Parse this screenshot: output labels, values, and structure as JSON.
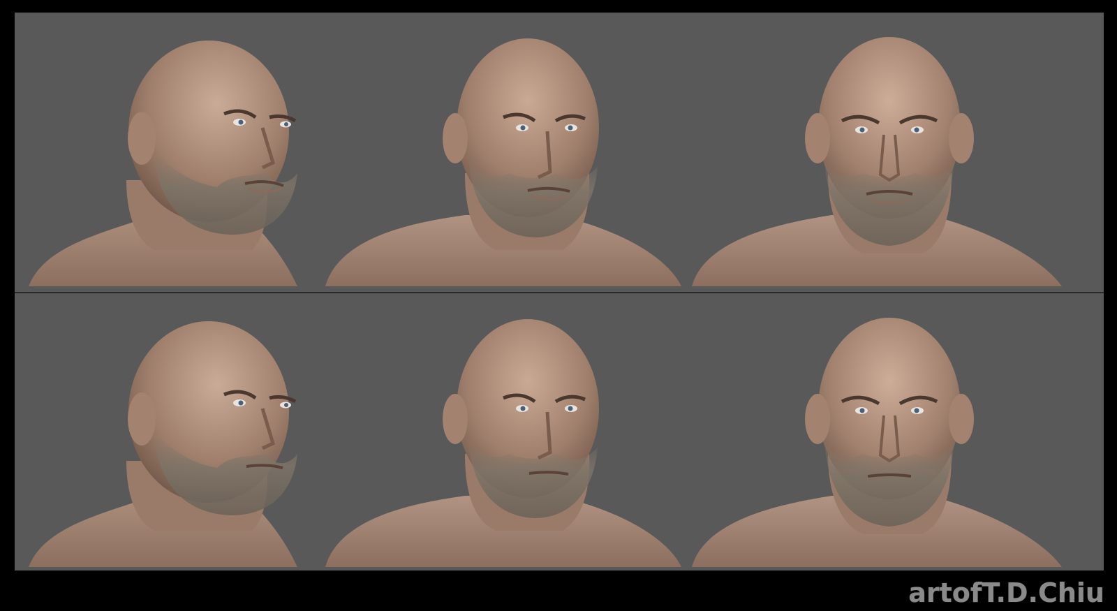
{
  "artwork": {
    "description_rows": [
      {
        "row": "top",
        "views": [
          "three-quarter",
          "slight-turn",
          "front"
        ]
      },
      {
        "row": "bottom",
        "views": [
          "three-quarter",
          "slight-turn",
          "front"
        ]
      }
    ],
    "watermark": "artofT.D.Chiu"
  },
  "colors": {
    "background_frame": "#000000",
    "panel_gray": "#595959",
    "skin_light": "#b89a88",
    "skin_mid": "#9c7c6a",
    "skin_dark": "#6e5446",
    "stubble": "#7d7468",
    "watermark_text": "#8a8a8a"
  }
}
